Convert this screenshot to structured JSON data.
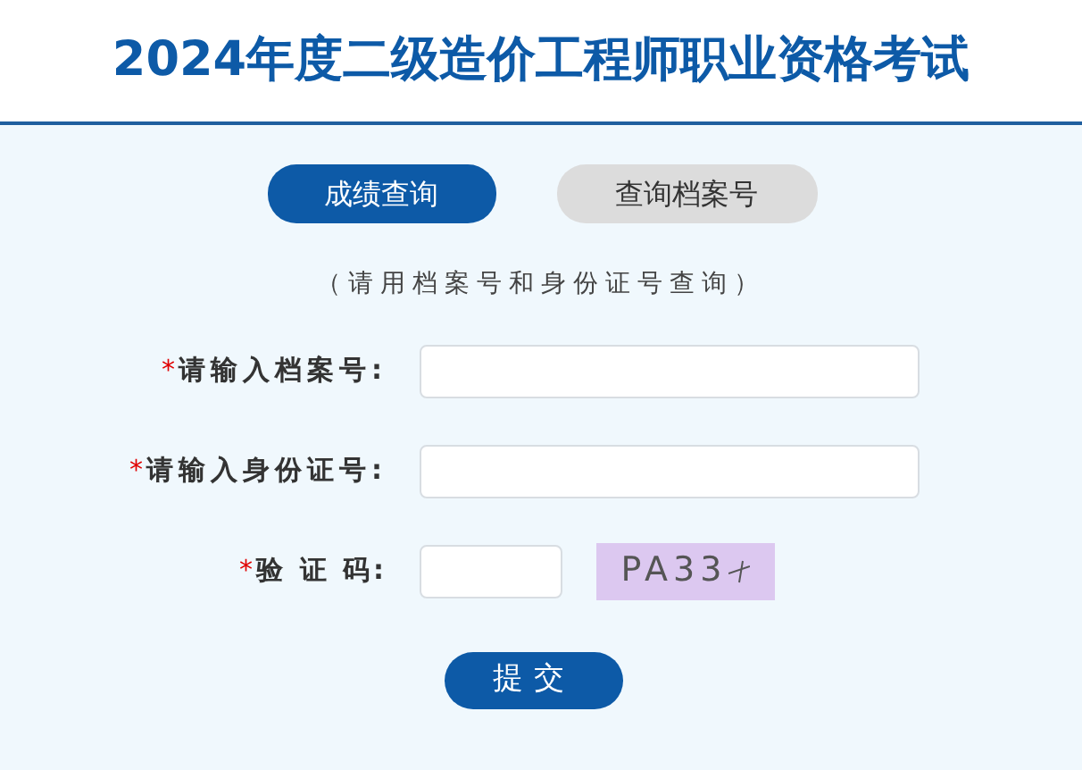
{
  "header": {
    "title": "2024年度二级造价工程师职业资格考试"
  },
  "tabs": [
    {
      "label": "成绩查询",
      "selected": true
    },
    {
      "label": "查询档案号",
      "selected": false
    }
  ],
  "hint": "（请用档案号和身份证号查询）",
  "fields": [
    {
      "kind": "text",
      "required": "*",
      "label": "请输入档案号:"
    },
    {
      "kind": "text",
      "required": "*",
      "label": "请输入身份证号:"
    },
    {
      "kind": "captcha",
      "required": "*",
      "label": "验 证 码:",
      "captcha": "PA33"
    }
  ],
  "submit": "提交"
}
